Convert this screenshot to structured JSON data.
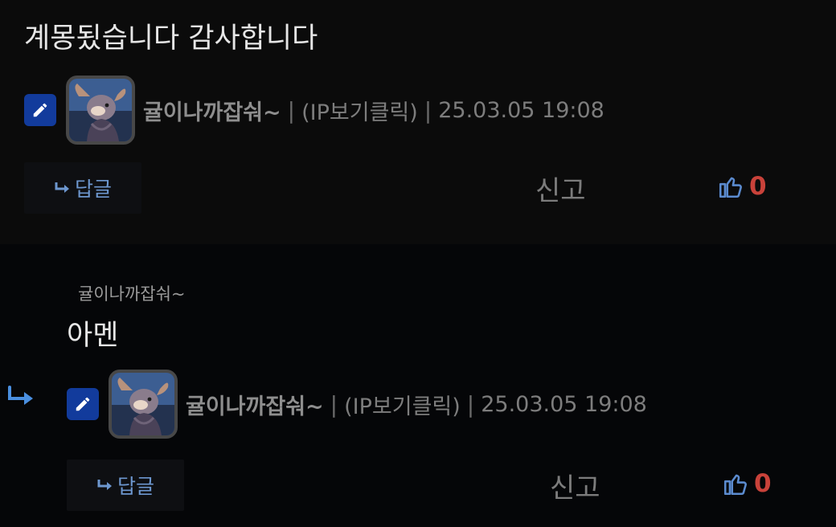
{
  "colors": {
    "like_count": "#c9423a",
    "reply_button_text": "#6d97cf",
    "edit_badge": "#123b9c",
    "reply_arrow": "#4a8fe0"
  },
  "comments": [
    {
      "body": "계몽됬습니다 감사합니다",
      "author": "귤이나까잡숴~",
      "ip_label": "(IP보기클릭)",
      "timestamp": "25.03.05 19:08",
      "reply_label": "답글",
      "report_label": "신고",
      "like_count": "0",
      "icons": [
        "pencil-icon",
        "avatar",
        "reply-arrow-icon",
        "thumbs-up-icon"
      ]
    },
    {
      "mention": "귤이나까잡숴~",
      "body": "아멘",
      "author": "귤이나까잡숴~",
      "ip_label": "(IP보기클릭)",
      "timestamp": "25.03.05 19:08",
      "reply_label": "답글",
      "report_label": "신고",
      "like_count": "0",
      "icons": [
        "nested-reply-arrow-icon",
        "pencil-icon",
        "avatar",
        "reply-arrow-icon",
        "thumbs-up-icon"
      ]
    }
  ],
  "separator": "|"
}
